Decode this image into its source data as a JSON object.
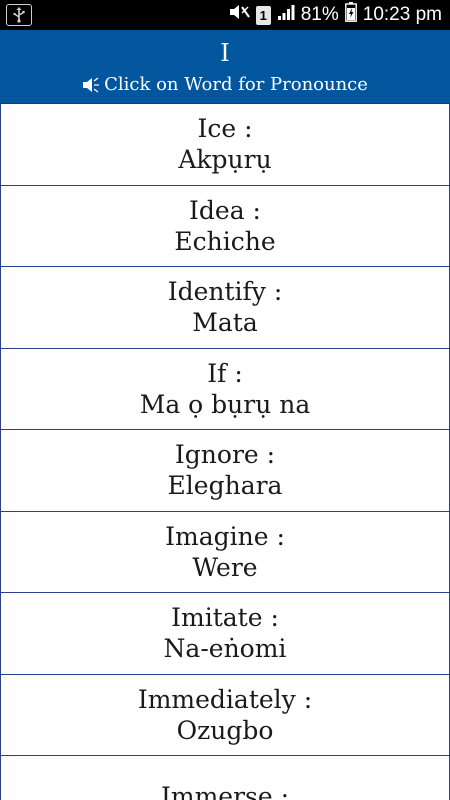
{
  "status_bar": {
    "battery_percent": "81%",
    "time": "10:23 pm",
    "sim_label": "1",
    "icons": [
      "usb-icon",
      "mute-icon",
      "sim-icon",
      "signal-icon",
      "battery-icon"
    ]
  },
  "header": {
    "title": "I",
    "subtitle": "Click on Word for Pronounce",
    "icon": "speaker-icon",
    "background": "#02569e"
  },
  "words": [
    {
      "english": "Ice :",
      "igbo": "Akpụrụ"
    },
    {
      "english": "Idea :",
      "igbo": "Echiche"
    },
    {
      "english": "Identify :",
      "igbo": "Mata"
    },
    {
      "english": "If :",
      "igbo": "Ma ọ bụrụ na"
    },
    {
      "english": "Ignore :",
      "igbo": "Eleghara"
    },
    {
      "english": "Imagine :",
      "igbo": "Were"
    },
    {
      "english": "Imitate :",
      "igbo": "Na-eṅomi"
    },
    {
      "english": "Immediately :",
      "igbo": "Ozugbo"
    },
    {
      "english": "Immerse :",
      "igbo": ""
    }
  ]
}
